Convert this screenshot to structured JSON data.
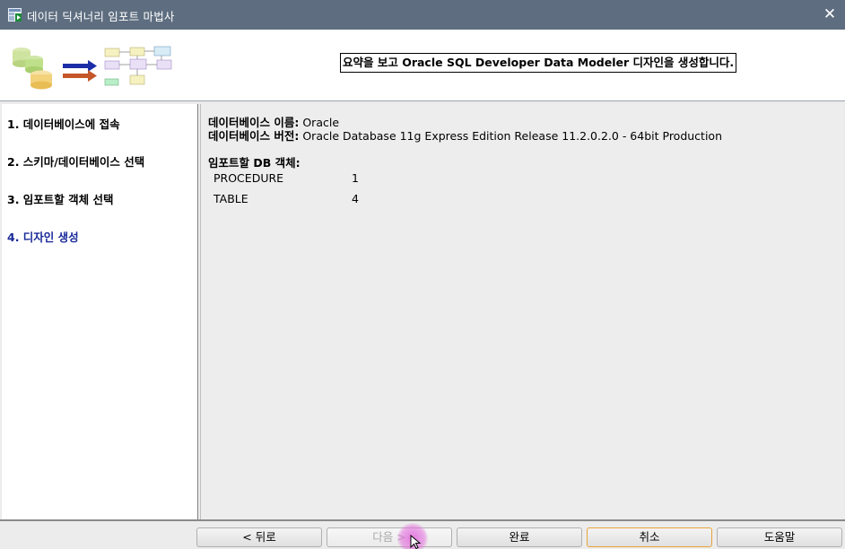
{
  "window": {
    "title": "데이터 딕셔너리 임포트 마법사",
    "close_glyph": "✕"
  },
  "banner": {
    "message": "요약을 보고 Oracle SQL Developer Data Modeler 디자인을 생성합니다."
  },
  "steps": [
    {
      "label": "1. 데이터베이스에 접속"
    },
    {
      "label": "2. 스키마/데이터베이스 선택"
    },
    {
      "label": "3. 임포트할 객체 선택"
    },
    {
      "label": "4. 디자인 생성"
    }
  ],
  "summary": {
    "db_name_label": "데이터베이스 이름:",
    "db_name_value": "Oracle",
    "db_version_label": "데이터베이스 버전:",
    "db_version_value": "Oracle Database 11g Express Edition Release 11.2.0.2.0 - 64bit Production",
    "objects_label": "임포트할 DB 객체:",
    "objects": [
      {
        "type": "PROCEDURE",
        "count": "1"
      },
      {
        "type": "TABLE",
        "count": "4"
      }
    ]
  },
  "footer": {
    "back": "< 뒤로",
    "next": "다음 >",
    "finish": "완료",
    "cancel": "취소",
    "help": "도움말"
  },
  "colors": {
    "titlebar": "#5e6e80",
    "active_step": "#1a2a9a",
    "focus_border": "#e8a33a"
  }
}
